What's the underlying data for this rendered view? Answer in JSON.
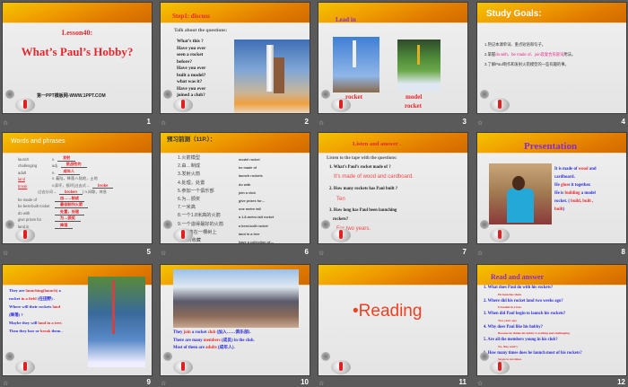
{
  "slides": [
    {
      "number": "1",
      "lesson": "Lesson40:",
      "title": "What’s Paul’s Hobby?",
      "footer": "第一PPT模板网-WWW.1PPT.COM"
    },
    {
      "number": "2",
      "heading": "Step1: discuss",
      "intro": "Talk about  the questions:",
      "questions": [
        "What’s this ?",
        "Have you ever",
        "seen a rocket",
        "before?",
        "Have you ever",
        "built a model?",
        "what was it?",
        "Have you ever",
        "joined a club?"
      ]
    },
    {
      "number": "3",
      "heading": "Lead in",
      "labels": [
        "rocket",
        "model",
        "rocket"
      ]
    },
    {
      "number": "4",
      "heading": "Study  Goals:",
      "goals": [
        [
          {
            "t": "1.熟记本课单词、重点短语和句子。"
          }
        ],
        [
          {
            "t": "2.掌握"
          },
          {
            "t": "do with、be made of、join及复合形容词",
            "c": "#e8268a"
          },
          {
            "t": "用法。"
          }
        ],
        [
          {
            "t": "3.了解Paul制作和发射火箭模型的一些有趣的事。"
          }
        ]
      ]
    },
    {
      "number": "5",
      "heading": "Words and phrases",
      "words": [
        {
          "w": "launch",
          "p": "v.",
          "a": "发射"
        },
        {
          "w": "challenging",
          "p": "adj.",
          "a": "挑战性的"
        },
        {
          "w": "adult",
          "p": "n.",
          "a": "成年人"
        },
        {
          "w": "land",
          "p": "v. 着陆，降落 n.陆地，土地",
          "a": ""
        },
        {
          "w": "break",
          "p": "v.弄坏，损坏(过去式→",
          "a": "broke"
        },
        {
          "w": "",
          "p": "过去分词→",
          "a": "broken",
          "s": ") n.间歇，休息"
        },
        {
          "w": "be made of",
          "p": "",
          "a": "由……制成"
        },
        {
          "w": "be best-built rocket",
          "p": "",
          "a": "最佳制作火箭"
        },
        {
          "w": "do with",
          "p": "",
          "a": "处置，处理"
        },
        {
          "w": "give prizes for",
          "p": "",
          "a": "为…颁奖"
        },
        {
          "w": "land in",
          "p": "",
          "a": "降落"
        }
      ]
    },
    {
      "number": "6",
      "heading": "预习前测（11P.）：",
      "cn": [
        "1.火箭模型",
        "2.由…制成",
        "3.发射火箭",
        "4.处理，处置",
        "5.参加一个俱乐部",
        "6.为…颁奖",
        "7.一米高",
        "8.一个1.8米高的火箭",
        "9.一个造得最好的火箭",
        "10.降落在一棵树上",
        "有…的收藏"
      ],
      "en": [
        "model rocket",
        "be made of",
        "launch rockets",
        "do with",
        "join a club",
        "give prizes for…",
        "one metre tall",
        "a 1.8-metre-tall rocket",
        "a best-built rocket",
        "land in a tree",
        "have a collection of—"
      ]
    },
    {
      "number": "7",
      "heading": "Listen and answer .",
      "intro": "Listen to the tape with  the questions:",
      "qa": [
        {
          "q": "1. What’s  Paul’s rocket made  of ?",
          "a": "It’s made of wood and cardboard."
        },
        {
          "q": "2. How  many  rockets has Paul built  ?",
          "a": "Ten"
        },
        {
          "q": "3. How  long has Paul been  launching",
          "q2": "rockets?",
          "a": "For two years."
        }
      ]
    },
    {
      "number": "8",
      "heading": "Presentation",
      "lines": [
        [
          {
            "t": "It is made  of ",
            "c": "#2b2bdc"
          },
          {
            "t": "wood",
            "c": "#e8262d"
          },
          {
            "t": "  and",
            "c": "#2b2bdc"
          }
        ],
        [
          {
            "t": "cardboard.",
            "c": "#2b2bdc"
          }
        ],
        [
          {
            "t": "He ",
            "c": "#2b2bdc"
          },
          {
            "t": "glue",
            "c": "#e8262d"
          },
          {
            "t": "s it together.",
            "c": "#2b2bdc"
          }
        ],
        [
          {
            "t": "He is ",
            "c": "#2b2bdc"
          },
          {
            "t": "building",
            "c": "#e8262d"
          },
          {
            "t": "  a model",
            "c": "#2b2bdc"
          }
        ],
        [
          {
            "t": "rocket. ( ",
            "c": "#2b2bdc"
          },
          {
            "t": "build,  built  ,",
            "c": "#e8262d"
          }
        ],
        [
          {
            "t": "built",
            "c": "#e8262d"
          },
          {
            "t": ")",
            "c": "#2b2bdc"
          }
        ]
      ]
    },
    {
      "number": "9",
      "lines": [
        [
          {
            "t": "They are ",
            "c": "#2b2bdc"
          },
          {
            "t": "launching(launch)",
            "c": "#e8262d"
          },
          {
            "t": " a",
            "c": "#2b2bdc"
          }
        ],
        [
          {
            "t": "rocket ",
            "c": "#2b2bdc"
          },
          {
            "t": "in a field",
            "c": "#e8262d"
          },
          {
            "t": " (在田野) .",
            "c": "#2b2bdc"
          }
        ],
        [
          {
            "t": " Where will their rockets ",
            "c": "#2b2bdc"
          },
          {
            "t": "land",
            "c": "#e8262d"
          }
        ],
        [
          {
            "t": "(降落) ?",
            "c": "#2b2bdc"
          }
        ],
        [
          {
            "t": "Maybe they will ",
            "c": "#2b2bdc"
          },
          {
            "t": "land in a tree.",
            "c": "#e8262d"
          }
        ],
        [
          {
            "t": "Then they lose or ",
            "c": "#2b2bdc"
          },
          {
            "t": "break",
            "c": "#e8262d"
          },
          {
            "t": " them .",
            "c": "#2b2bdc"
          }
        ]
      ]
    },
    {
      "number": "10",
      "lines": [
        [
          {
            "t": "They ",
            "c": "#2b2bdc"
          },
          {
            "t": "join",
            "c": "#e8262d"
          },
          {
            "t": " a rocket ",
            "c": "#2b2bdc"
          },
          {
            "t": "club",
            "c": "#e8262d"
          },
          {
            "t": " (加入……俱乐部).",
            "c": "#2b2bdc"
          }
        ],
        [
          {
            "t": "There are many ",
            "c": "#2b2bdc"
          },
          {
            "t": "members",
            "c": "#e8262d"
          },
          {
            "t": " (成员) in the club.",
            "c": "#2b2bdc"
          }
        ],
        [
          {
            "t": "Most of them are ",
            "c": "#2b2bdc"
          },
          {
            "t": "adults",
            "c": "#e8262d"
          },
          {
            "t": " (成年人).",
            "c": "#2b2bdc"
          }
        ]
      ]
    },
    {
      "number": "11",
      "title": "•Reading"
    },
    {
      "number": "12",
      "heading": "Read and answer",
      "qa": [
        {
          "q": "1. What does Paul do with his rockets?",
          "a": "He  launches them."
        },
        {
          "q": "2. Where did his rocket land two weeks ago?",
          "a": "It landed in a tree."
        },
        {
          "q": "3. When did Paul begin to launch his rockets?",
          "a": "Two years ago."
        },
        {
          "q": "4. Why does Paul like his hobby?",
          "a": "Because he thinks his hobby is exciting and challenging."
        },
        {
          "q": "5. Are all the members young in his club?",
          "a": "No, they aren’t."
        },
        {
          "q": "6. How many times does he launch most of his rockets?",
          "a": "Seven to ten times."
        }
      ]
    }
  ],
  "colors": {
    "background": "#5a5a5a",
    "header_orange": "#e07800",
    "text_red": "#e8262d",
    "text_blue": "#2b2bdc",
    "text_purple": "#8a2ec8"
  }
}
